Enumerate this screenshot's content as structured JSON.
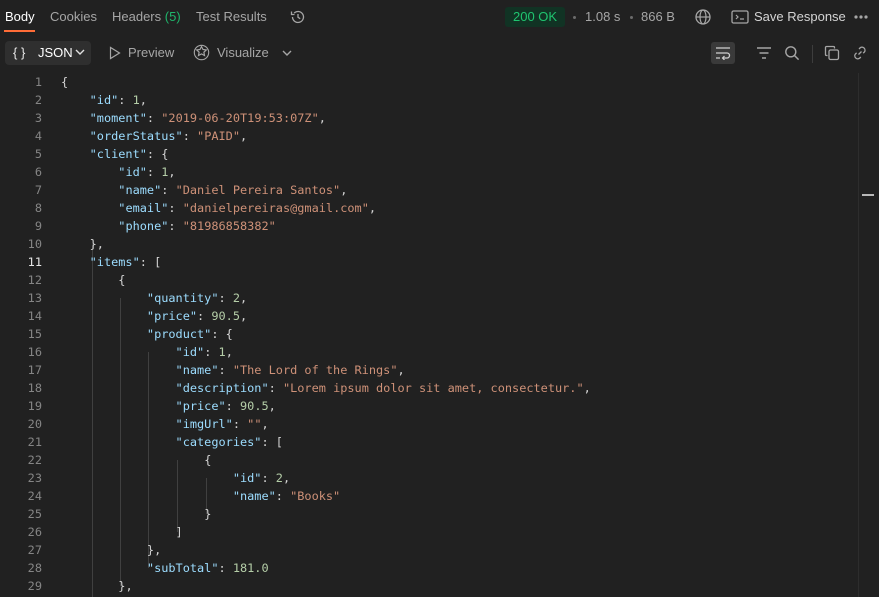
{
  "tabs": [
    {
      "label": "Body"
    },
    {
      "label": "Cookies"
    },
    {
      "label": "Headers",
      "count": "(5)"
    },
    {
      "label": "Test Results"
    }
  ],
  "status": {
    "code": "200 OK",
    "time": "1.08 s",
    "size": "866 B"
  },
  "save_response": "Save Response",
  "toolbar": {
    "format": "JSON",
    "braces": "{ }",
    "preview": "Preview",
    "visualize": "Visualize"
  },
  "icons": [
    "history-icon",
    "globe-icon",
    "save-icon",
    "more-icon",
    "chevron-down-icon",
    "play-icon",
    "visualize-icon",
    "wrap-icon",
    "filter-icon",
    "search-icon",
    "copy-icon",
    "link-icon"
  ],
  "colors": {
    "status_ok": "#1fc46f",
    "accent": "#ff6c37",
    "count": "#1fb56b"
  },
  "current_line": 11,
  "lines": [
    {
      "n": "1"
    },
    {
      "n": "2"
    },
    {
      "n": "3"
    },
    {
      "n": "4"
    },
    {
      "n": "5"
    },
    {
      "n": "6"
    },
    {
      "n": "7"
    },
    {
      "n": "8"
    },
    {
      "n": "9"
    },
    {
      "n": "10"
    },
    {
      "n": "11"
    },
    {
      "n": "12"
    },
    {
      "n": "13"
    },
    {
      "n": "14"
    },
    {
      "n": "15"
    },
    {
      "n": "16"
    },
    {
      "n": "17"
    },
    {
      "n": "18"
    },
    {
      "n": "19"
    },
    {
      "n": "20"
    },
    {
      "n": "21"
    },
    {
      "n": "22"
    },
    {
      "n": "23"
    },
    {
      "n": "24"
    },
    {
      "n": "25"
    },
    {
      "n": "26"
    },
    {
      "n": "27"
    },
    {
      "n": "28"
    },
    {
      "n": "29"
    }
  ],
  "code": {
    "l1": "{",
    "l2": {
      "key": "\"id\"",
      "val": "1"
    },
    "l3": {
      "key": "\"moment\"",
      "val": "\"2019-06-20T19:53:07Z\""
    },
    "l4": {
      "key": "\"orderStatus\"",
      "val": "\"PAID\""
    },
    "l5": {
      "key": "\"client\"",
      "open": "{"
    },
    "l6": {
      "key": "\"id\"",
      "val": "1"
    },
    "l7": {
      "key": "\"name\"",
      "val": "\"Daniel Pereira Santos\""
    },
    "l8": {
      "key": "\"email\"",
      "val": "\"danielpereiras@gmail.com\""
    },
    "l9": {
      "key": "\"phone\"",
      "val": "\"81986858382\""
    },
    "l10": "},",
    "l11": {
      "key": "\"items\"",
      "open": "["
    },
    "l12": "{",
    "l13": {
      "key": "\"quantity\"",
      "val": "2"
    },
    "l14": {
      "key": "\"price\"",
      "val": "90.5"
    },
    "l15": {
      "key": "\"product\"",
      "open": "{"
    },
    "l16": {
      "key": "\"id\"",
      "val": "1"
    },
    "l17": {
      "key": "\"name\"",
      "val": "\"The Lord of the Rings\""
    },
    "l18": {
      "key": "\"description\"",
      "val": "\"Lorem ipsum dolor sit amet, consectetur.\""
    },
    "l19": {
      "key": "\"price\"",
      "val": "90.5"
    },
    "l20": {
      "key": "\"imgUrl\"",
      "val": "\"\""
    },
    "l21": {
      "key": "\"categories\"",
      "open": "["
    },
    "l22": "{",
    "l23": {
      "key": "\"id\"",
      "val": "2"
    },
    "l24": {
      "key": "\"name\"",
      "val": "\"Books\""
    },
    "l25": "}",
    "l26": "]",
    "l27": "},",
    "l28": {
      "key": "\"subTotal\"",
      "val": "181.0"
    },
    "l29": "},"
  }
}
